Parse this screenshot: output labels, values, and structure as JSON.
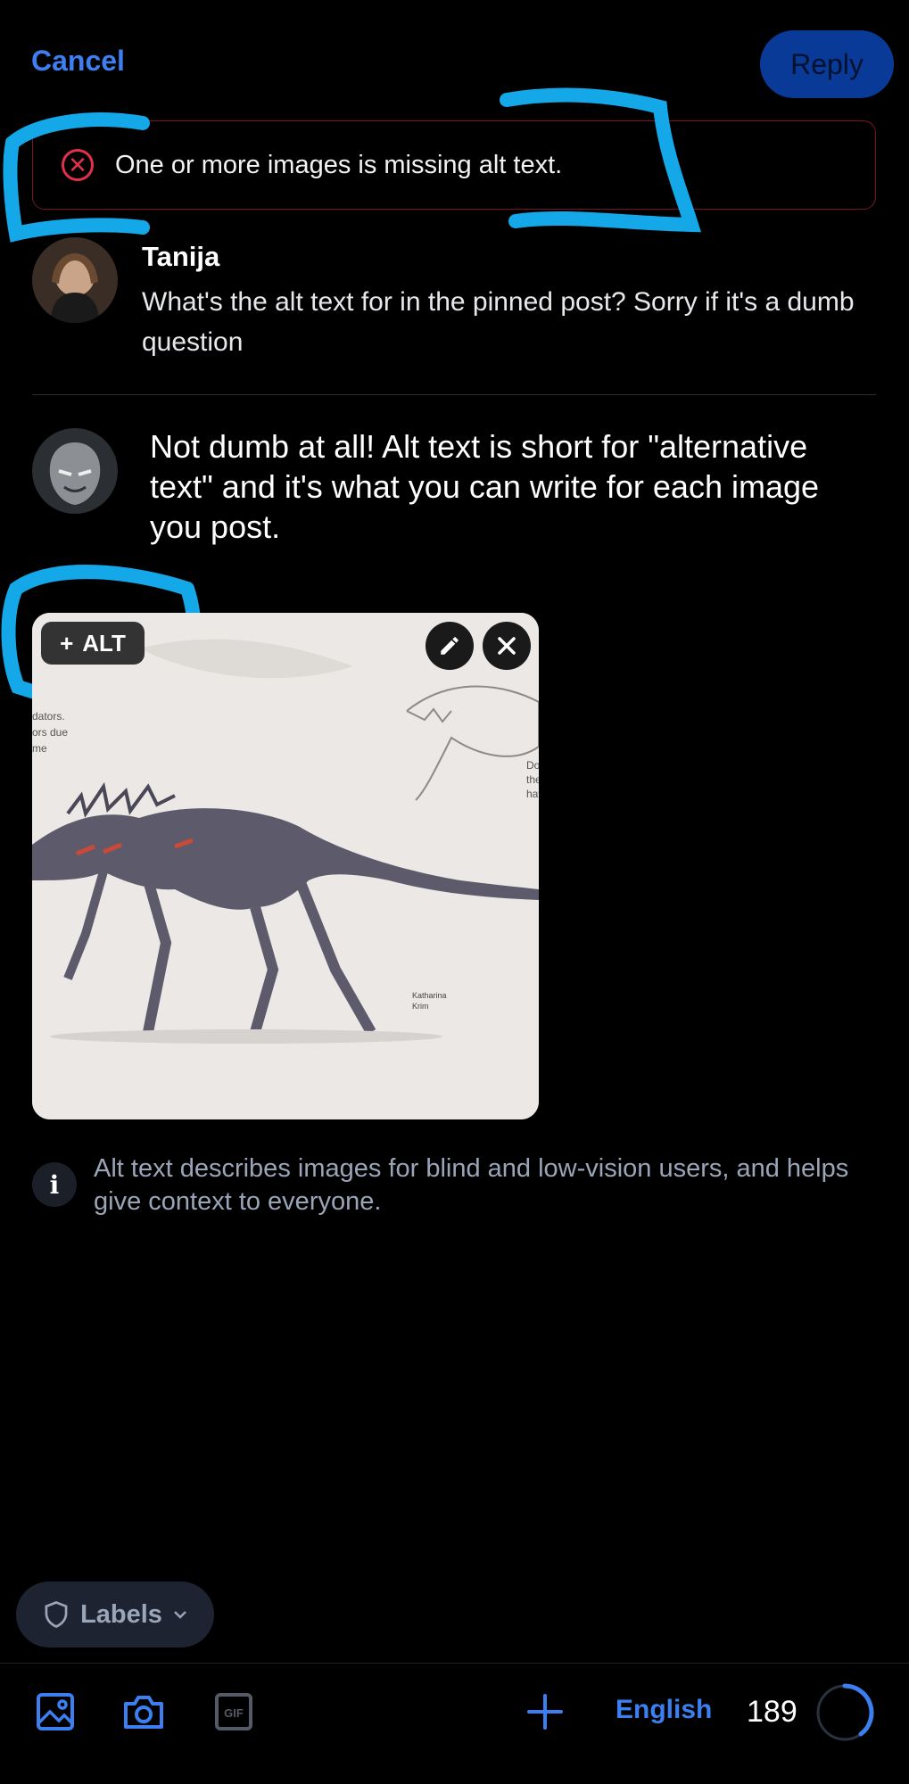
{
  "header": {
    "cancel_label": "Cancel",
    "reply_label": "Reply"
  },
  "error": {
    "message": "One or more images is missing alt text."
  },
  "parent_post": {
    "author": "Tanija",
    "text": "What's the alt text for in the pinned post? Sorry if it's a dumb question"
  },
  "composer": {
    "text": "Not dumb at all! Alt text is short for \"alternative text\" and it's what you can write for each image you post."
  },
  "image": {
    "alt_button_label": "ALT",
    "artwork_text": {
      "left_snippet": [
        "...ators.",
        "...ors due",
        "...me"
      ],
      "right_snippet": [
        "Do",
        "the",
        "hav"
      ],
      "signature": "Katharina Krim"
    }
  },
  "hint": {
    "text": "Alt text describes images for blind and low-vision users, and helps give context to everyone."
  },
  "labels_button": {
    "label": "Labels"
  },
  "toolbar": {
    "language": "English",
    "char_count": "189",
    "icons": [
      "image-icon",
      "camera-icon",
      "gif-icon",
      "plus-icon",
      "progress-ring"
    ]
  },
  "colors": {
    "accent": "#3b7ff0",
    "error": "#e0304a",
    "reply_btn": "#0a3a97",
    "muted": "#9aa5b8"
  }
}
